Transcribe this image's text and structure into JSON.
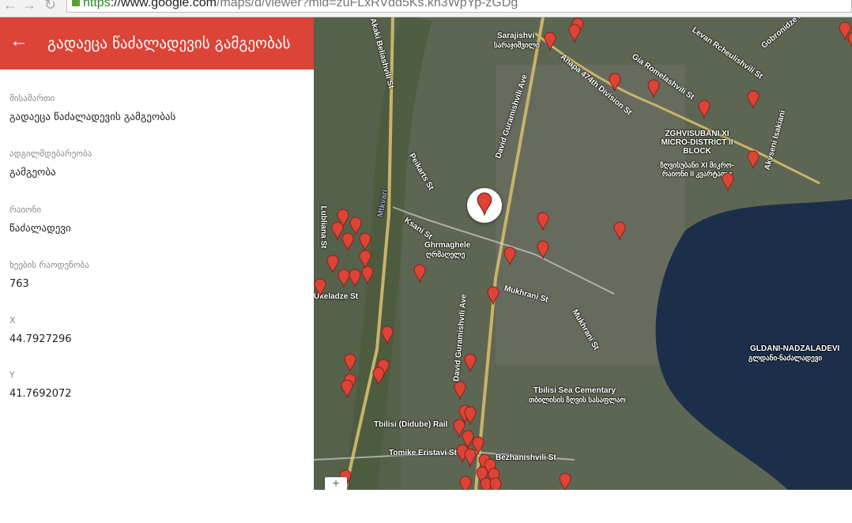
{
  "browser": {
    "url_scheme": "https",
    "url_host": "://www.google.com",
    "url_path": "/maps/d/viewer?mid=zuFLxRVdd5Ks.kh3WpYp-zGDg"
  },
  "panel": {
    "title": "გადაეცა წაძალადევის გამგეობას",
    "fields": [
      {
        "label": "მისამართი",
        "value": "გადაეცა წაძალადევის გამგეობას"
      },
      {
        "label": "ადგილმდებარეობა",
        "value": "გამგეობა"
      },
      {
        "label": "რაიონი",
        "value": "წაძალადევი"
      },
      {
        "label": "ხეების რაოდენობა",
        "value": "763"
      },
      {
        "label": "X",
        "value": "44.7927296"
      },
      {
        "label": "Y",
        "value": "41.7692072"
      }
    ]
  },
  "map": {
    "labels": [
      "Sarajishvi",
      "სარაჯიშვილი",
      "Anapa 474th Division St",
      "Gia Romelashvili St",
      "Levan Rcheulishvili St",
      "Gobronidze St",
      "ZGHVISUBANI XI MICRO-DISTRICT II BLOCK",
      "ზღვისუბანი XI მიკრო-რაიონი II კვარტალი",
      "Akvseni Isakiani",
      "David Guramishvili Ave",
      "Peikarts St",
      "Ksani St",
      "Ghrmaghele",
      "ღრმაღელე",
      "Mukhrani St",
      "Mukhrani St",
      "Akaki Beliashvili St",
      "Lubliana St",
      "Mtkvari",
      "Tbilisi Sea Cementary",
      "თბილისის ზღვის სასაფლაო",
      "GLDANI-NADZALADEVI",
      "გლდანი-ნაძალადევი",
      "Tbilisi (Didube) Rail",
      "Tomike Eristavi St",
      "Bezhanishvili St",
      "Ukeladze St",
      "David Guramishvili Ave"
    ],
    "zoom_in": "+",
    "colors": {
      "marker": "#db4437",
      "lake": "#1c2f4a"
    }
  }
}
